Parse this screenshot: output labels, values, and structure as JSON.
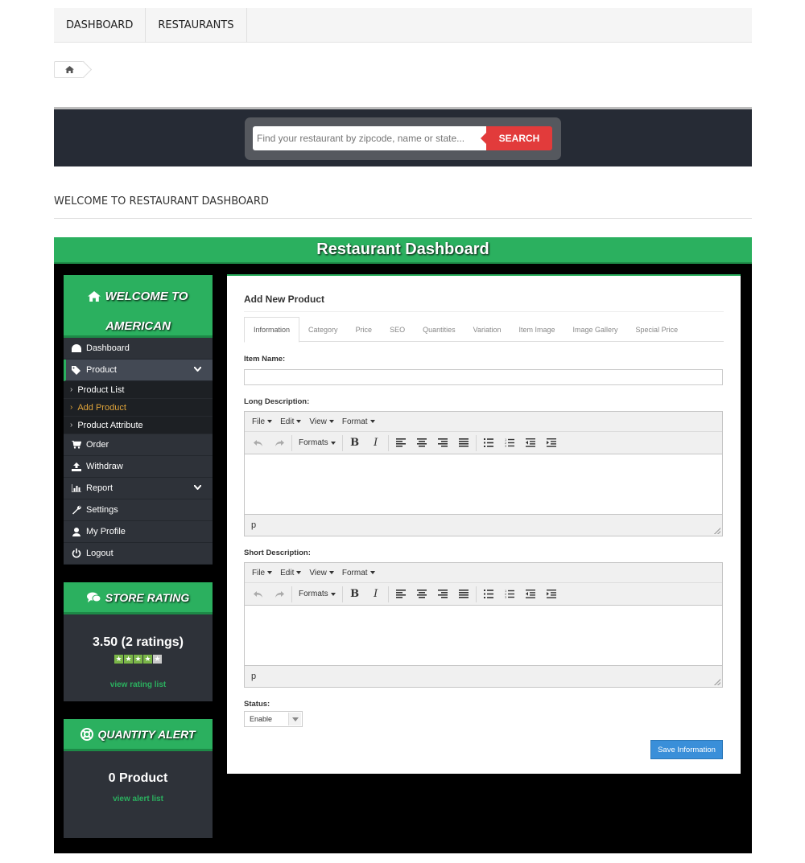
{
  "topnav": {
    "items": [
      {
        "label": "DASHBOARD"
      },
      {
        "label": "RESTAURANTS"
      }
    ]
  },
  "search": {
    "placeholder": "Find your restaurant by zipcode, name or state...",
    "button_label": "SEARCH"
  },
  "welcome_heading": "WELCOME TO RESTAURANT DASHBOARD",
  "dashboard": {
    "title": "Restaurant Dashboard",
    "welcome_line1": "WELCOME TO",
    "welcome_line2": "AMERICAN",
    "menu": {
      "dashboard": "Dashboard",
      "product": "Product",
      "product_sub": [
        "Product List",
        "Add Product",
        "Product Attribute"
      ],
      "order": "Order",
      "withdraw": "Withdraw",
      "report": "Report",
      "settings": "Settings",
      "my_profile": "My Profile",
      "logout": "Logout"
    },
    "store_rating": {
      "title": "STORE RATING",
      "value": "3.50 (2 ratings)",
      "stars_filled": 4,
      "stars_total": 5,
      "link": "view rating list"
    },
    "quantity_alert": {
      "title": "QUANTITY ALERT",
      "value": "0 Product",
      "link": "view alert list"
    }
  },
  "form": {
    "title": "Add New Product",
    "tabs": [
      "Information",
      "Category",
      "Price",
      "SEO",
      "Quantities",
      "Variation",
      "Item Image",
      "Image Gallery",
      "Special Price"
    ],
    "item_name_label": "Item Name:",
    "item_name_value": "",
    "long_desc_label": "Long Description:",
    "short_desc_label": "Short Description:",
    "editor": {
      "menus": [
        "File",
        "Edit",
        "View",
        "Format"
      ],
      "formats_label": "Formats",
      "bold": "B",
      "italic": "I",
      "path": "p"
    },
    "status_label": "Status:",
    "status_value": "Enable",
    "save_label": "Save Information"
  },
  "colors": {
    "accent_green": "#2bb05f",
    "search_red": "#e23b3b",
    "save_blue": "#3a8fd9",
    "sidebar_dark": "#2e3239",
    "active_sub": "#e0a43a"
  }
}
